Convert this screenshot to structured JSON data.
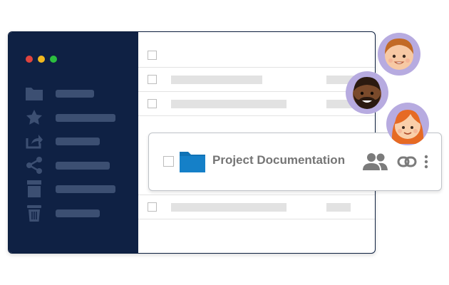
{
  "window": {
    "traffic_lights": [
      {
        "name": "close",
        "color": "#e0443e"
      },
      {
        "name": "minimize",
        "color": "#f1b81f"
      },
      {
        "name": "zoom",
        "color": "#2cbf3f"
      }
    ]
  },
  "sidebar": {
    "background": "#0f2144",
    "items": [
      {
        "icon": "folder-icon"
      },
      {
        "icon": "star-icon"
      },
      {
        "icon": "share-arrow-icon"
      },
      {
        "icon": "share-network-icon"
      },
      {
        "icon": "archive-box-icon"
      },
      {
        "icon": "trash-icon"
      }
    ]
  },
  "file_list": {
    "highlighted_item": {
      "name": "Project Documentation",
      "icon": "folder-icon",
      "folder_color": "#1072b5",
      "actions": [
        "shared-users-icon",
        "link-icon",
        "more-vertical-icon"
      ]
    }
  },
  "collaborators": [
    {
      "name": "avatar-girl-short-hair",
      "skin": "#f7c9a4",
      "hair": "#c26a26"
    },
    {
      "name": "avatar-man-beard",
      "skin": "#7a4a2b",
      "hair": "#2b1a10"
    },
    {
      "name": "avatar-girl-red-hair",
      "skin": "#f9cfaa",
      "hair": "#e66a24"
    }
  ],
  "colors": {
    "accent_avatar_ring": "#b7abe0",
    "sidebar_placeholder": "#3c4f72",
    "content_placeholder": "#e2e2e2"
  }
}
